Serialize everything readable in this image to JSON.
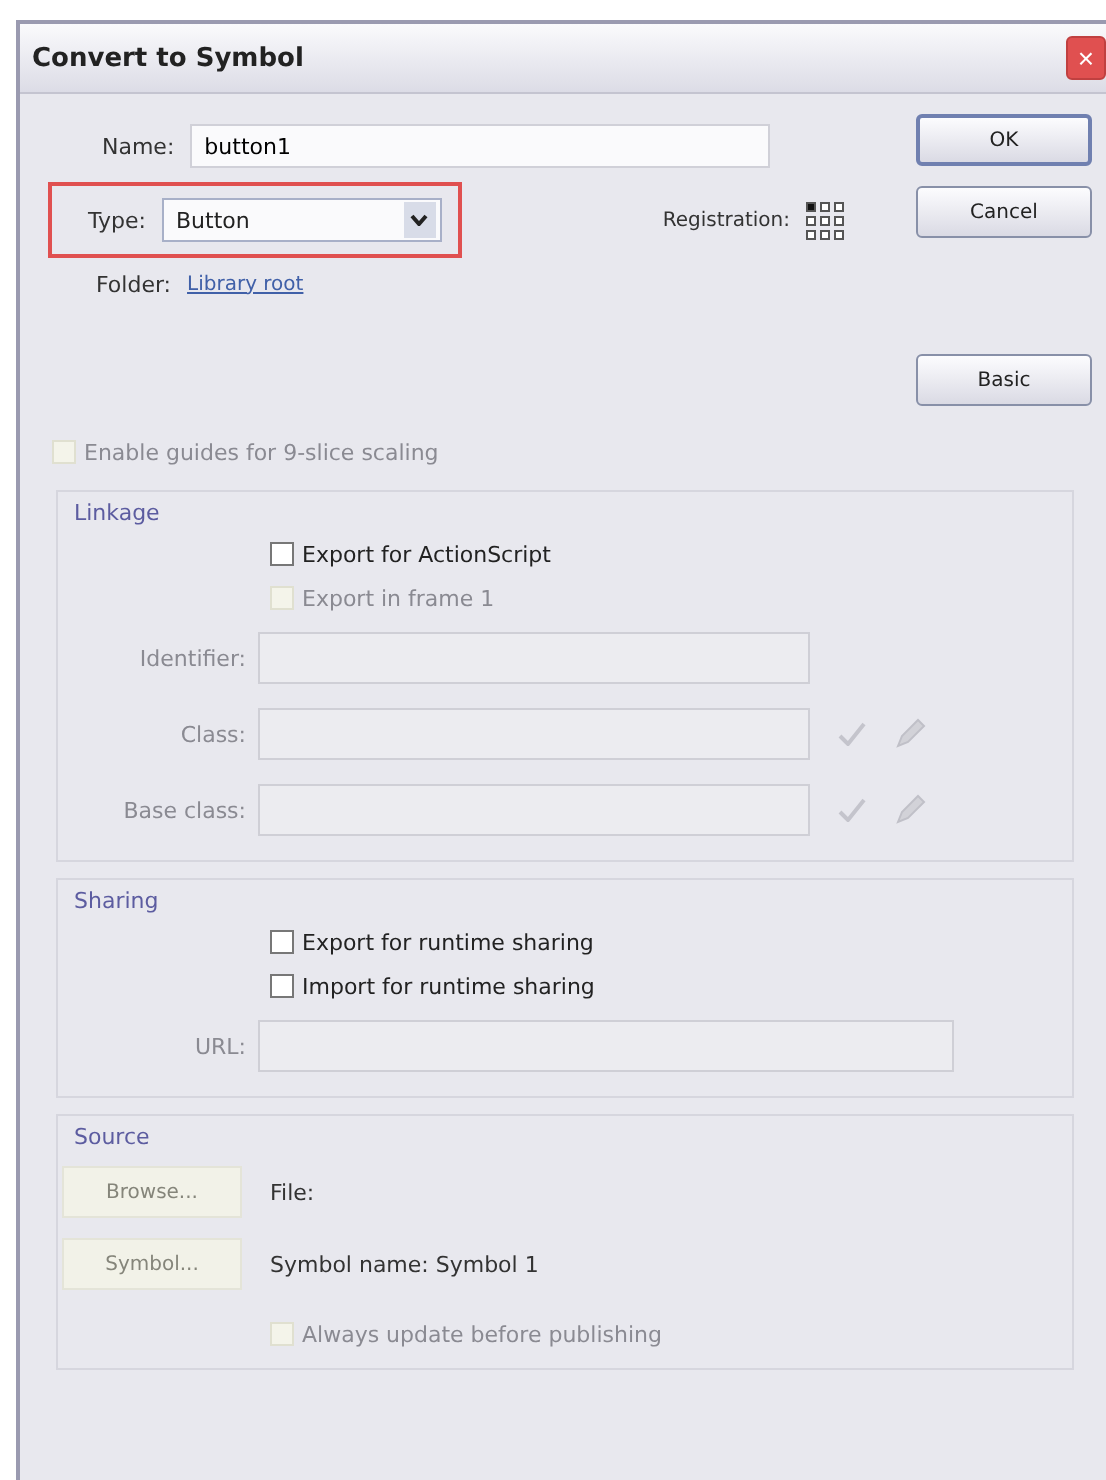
{
  "window": {
    "title": "Convert to Symbol",
    "close": "×"
  },
  "name_field": {
    "label": "Name:",
    "value": "button1"
  },
  "type_field": {
    "label": "Type:",
    "value": "Button",
    "highlighted": true
  },
  "registration": {
    "label": "Registration:",
    "points": [
      {
        "selected": true
      },
      {
        "selected": false
      },
      {
        "selected": false
      },
      {
        "selected": false
      },
      {
        "selected": false
      },
      {
        "selected": false
      },
      {
        "selected": false
      },
      {
        "selected": false
      },
      {
        "selected": false
      }
    ]
  },
  "folder": {
    "label": "Folder:",
    "link": "Library root"
  },
  "buttons": [
    {
      "label": "OK",
      "kind": "default"
    },
    {
      "label": "Cancel",
      "kind": "normal"
    },
    {
      "label": "Basic",
      "kind": "spaced"
    }
  ],
  "guides": {
    "label": "Enable guides for 9-slice scaling",
    "checked": false,
    "disabled": true
  },
  "linkage": {
    "title": "Linkage",
    "checkboxes": [
      {
        "label": "Export for ActionScript",
        "checked": false,
        "disabled": false
      },
      {
        "label": "Export in frame 1",
        "checked": false,
        "disabled": true
      }
    ],
    "fields": [
      {
        "label": "Identifier:",
        "kind": "plain",
        "disabled": true
      },
      {
        "label": "Class:",
        "kind": "with_icons",
        "disabled": true
      },
      {
        "label": "Base class:",
        "kind": "with_icons",
        "disabled": true
      }
    ]
  },
  "sharing": {
    "title": "Sharing",
    "checkboxes": [
      {
        "label": "Export for runtime sharing",
        "checked": false,
        "disabled": false
      },
      {
        "label": "Import for runtime sharing",
        "checked": false,
        "disabled": false
      }
    ],
    "fields": [
      {
        "label": "URL:",
        "kind": "wide",
        "disabled": true
      }
    ]
  },
  "source": {
    "title": "Source",
    "rows": [
      {
        "button": "Browse...",
        "text": "File:",
        "disabled": true
      },
      {
        "button": "Symbol...",
        "text": "Symbol name: Symbol 1",
        "disabled": true
      }
    ],
    "checkbox": {
      "label": "Always update before publishing",
      "checked": false,
      "disabled": true
    }
  }
}
